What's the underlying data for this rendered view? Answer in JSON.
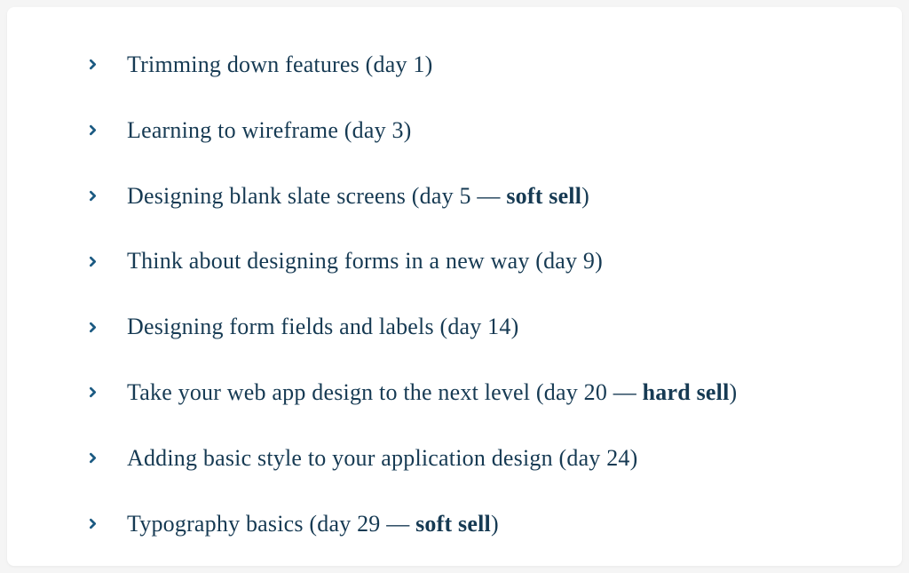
{
  "colors": {
    "text": "#163a53",
    "chevron": "#1b5a82",
    "card_bg": "#ffffff",
    "page_bg": "#f5f5f5"
  },
  "list": {
    "items": [
      {
        "text": "Trimming down features (day 1)",
        "day": 1,
        "sell": null
      },
      {
        "text": "Learning to wireframe (day 3)",
        "day": 3,
        "sell": null
      },
      {
        "prefix": "Designing blank slate screens (day 5 — ",
        "bold": "soft sell",
        "suffix": ")",
        "day": 5,
        "sell": "soft sell"
      },
      {
        "text": "Think about designing forms in a new way (day 9)",
        "day": 9,
        "sell": null
      },
      {
        "text": "Designing form fields and labels (day 14)",
        "day": 14,
        "sell": null
      },
      {
        "prefix": "Take your web app design to the next level (day 20 — ",
        "bold": "hard sell",
        "suffix": ")",
        "day": 20,
        "sell": "hard sell"
      },
      {
        "text": "Adding basic style to your application design (day 24)",
        "day": 24,
        "sell": null
      },
      {
        "prefix": "Typography basics (day 29 — ",
        "bold": "soft sell",
        "suffix": ")",
        "day": 29,
        "sell": "soft sell"
      }
    ]
  }
}
